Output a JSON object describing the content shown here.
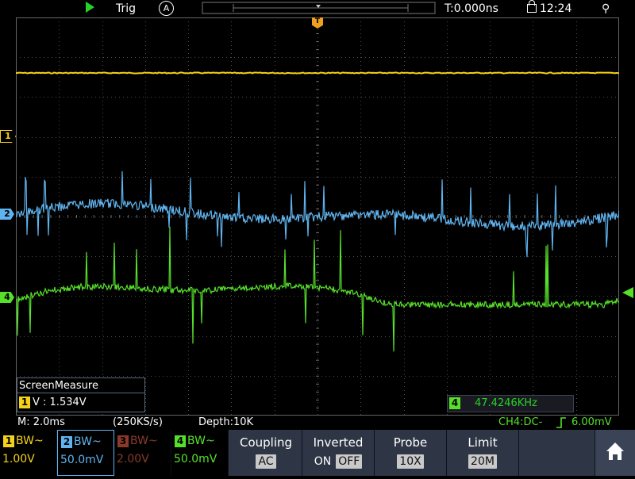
{
  "topbar": {
    "trig_label": "Trig",
    "auto_mode": "A",
    "time_offset": "T:0.000ns",
    "clock": "12:24"
  },
  "channel_markers": {
    "ch1": "1",
    "ch2": "2",
    "ch4": "4",
    "trigger": "T"
  },
  "colors": {
    "ch1": "#f5d21a",
    "ch2": "#5fb4f0",
    "ch3": "#8b3a2a",
    "ch4": "#56e02a",
    "grid": "#4a4a4a",
    "softbar": "#2e3646"
  },
  "measure": {
    "title": "ScreenMeasure",
    "channel": "1",
    "text": "V : 1.534V"
  },
  "frequency": {
    "channel": "4",
    "value": "47.4246KHz"
  },
  "info": {
    "timebase": "M: 2.0ms",
    "sample_rate": "(250KS/s)",
    "depth": "Depth:10K",
    "trigger_status": "CH4:DC-",
    "trigger_level": "6.00mV"
  },
  "channels": [
    {
      "num": "1",
      "coupling": "BW~",
      "scale": "1.00V"
    },
    {
      "num": "2",
      "coupling": "BW~",
      "scale": "50.0mV"
    },
    {
      "num": "3",
      "coupling": "BW~",
      "scale": "2.00V"
    },
    {
      "num": "4",
      "coupling": "BW~",
      "scale": "50.0mV"
    }
  ],
  "menu": {
    "coupling_label": "Coupling",
    "coupling_value": "AC",
    "inverted_label": "Inverted",
    "inverted_on": "ON",
    "inverted_off": "OFF",
    "probe_label": "Probe",
    "probe_value": "10X",
    "limit_label": "Limit",
    "limit_value": "20M"
  },
  "icons": {
    "run": "run-triangle-icon",
    "auto": "auto-trigger-icon",
    "lock": "lock-icon",
    "usb": "usb-icon",
    "home": "home-icon"
  }
}
